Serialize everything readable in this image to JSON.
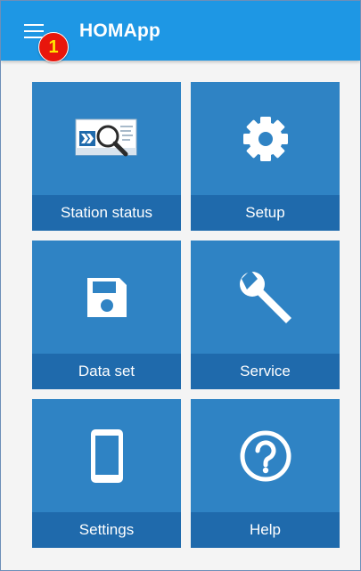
{
  "app": {
    "title": "HOMApp",
    "badge": "1"
  },
  "theme": {
    "appbar_color": "#1e97e4",
    "tile_color": "#2f83c4",
    "tile_label_color": "#1f6aac",
    "badge_color": "#e8160c",
    "badge_text_color": "#ffe600"
  },
  "tiles": [
    {
      "label": "Station status",
      "icon": "station-status-icon"
    },
    {
      "label": "Setup",
      "icon": "gear-icon"
    },
    {
      "label": "Data set",
      "icon": "floppy-disk-icon"
    },
    {
      "label": "Service",
      "icon": "wrench-icon"
    },
    {
      "label": "Settings",
      "icon": "smartphone-icon"
    },
    {
      "label": "Help",
      "icon": "question-circle-icon"
    }
  ]
}
